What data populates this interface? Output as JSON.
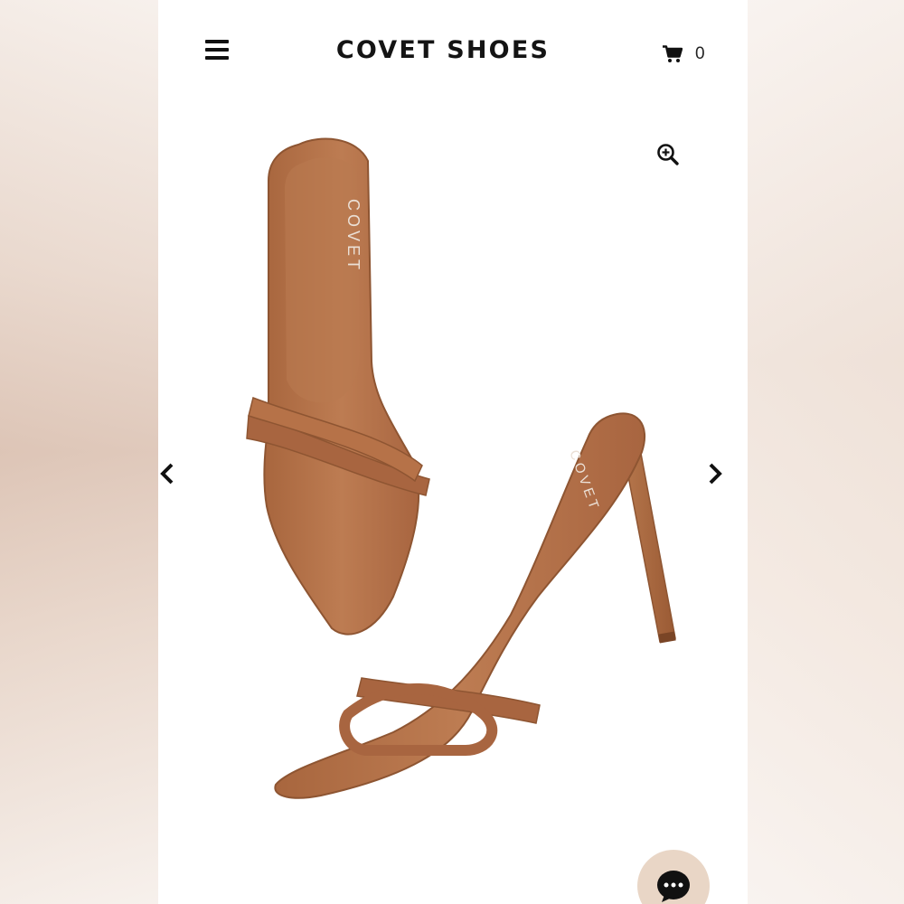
{
  "header": {
    "brand": "COVET SHOES",
    "cart_count": "0",
    "menu_icon": "hamburger-menu-icon",
    "cart_icon": "shopping-cart-icon"
  },
  "product": {
    "insole_logo_1": "COVET",
    "insole_logo_2": "COVET"
  },
  "gallery": {
    "zoom_icon": "zoom-in-icon",
    "prev_icon": "chevron-left-icon",
    "next_icon": "chevron-right-icon"
  },
  "chat": {
    "icon": "chat-bubble-icon"
  },
  "colors": {
    "leather": "#b06f47",
    "leather_dark": "#8e5532",
    "brand_text": "#141414",
    "chat_bg": "#e9d6c6"
  }
}
